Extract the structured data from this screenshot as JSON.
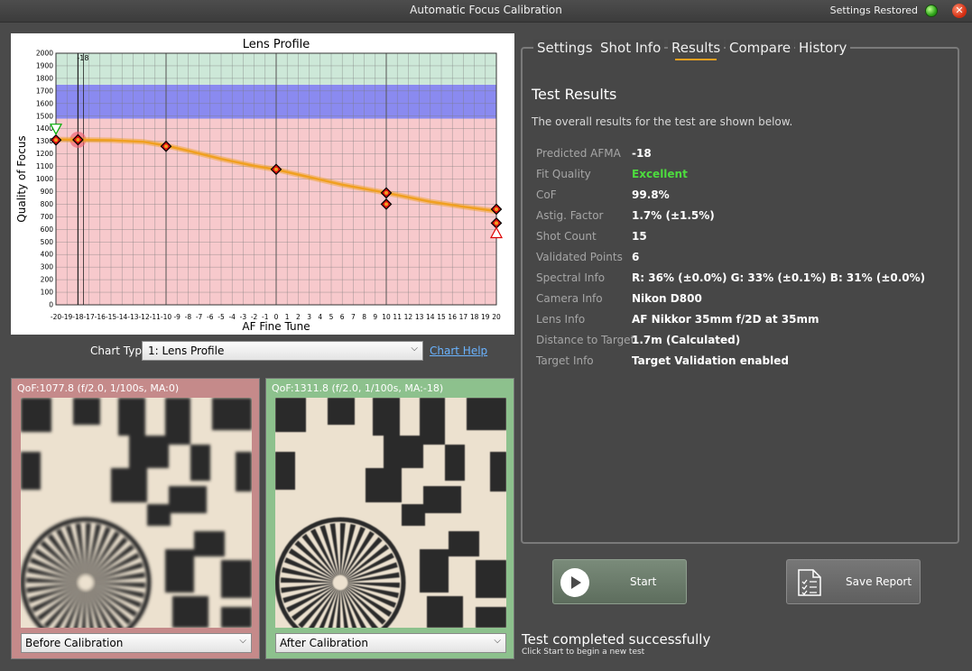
{
  "window": {
    "title": "Automatic Focus Calibration",
    "status_text": "Settings Restored",
    "close_glyph": "✕"
  },
  "chart_data": {
    "type": "line",
    "title": "Lens Profile",
    "xlabel": "AF Fine Tune",
    "ylabel": "Quality of Focus",
    "xlim": [
      -20,
      20
    ],
    "ylim": [
      0,
      2000
    ],
    "x_ticks": [
      -20,
      -19,
      -18,
      -17,
      -16,
      -15,
      -14,
      -13,
      -12,
      -11,
      -10,
      -9,
      -8,
      -7,
      -6,
      -5,
      -4,
      -3,
      -2,
      -1,
      0,
      1,
      2,
      3,
      4,
      5,
      6,
      7,
      8,
      9,
      10,
      11,
      12,
      13,
      14,
      15,
      16,
      17,
      18,
      19,
      20
    ],
    "y_ticks": [
      0,
      100,
      200,
      300,
      400,
      500,
      600,
      700,
      800,
      900,
      1000,
      1100,
      1200,
      1300,
      1400,
      1500,
      1600,
      1700,
      1800,
      1900,
      2000
    ],
    "grid": true,
    "bands": [
      {
        "from": 0,
        "to": 1480,
        "color": "#f7c9cc"
      },
      {
        "from": 1480,
        "to": 1750,
        "color": "#8a8af0"
      },
      {
        "from": 1750,
        "to": 2000,
        "color": "#cde8d8"
      }
    ],
    "predicted_marker": {
      "x": -18,
      "label": "-18"
    },
    "fit_curve": {
      "name": "Fit",
      "color": "#f0a020",
      "x": [
        -20,
        -18,
        -15,
        -12,
        -10,
        -8,
        -5,
        -2,
        0,
        3,
        6,
        10,
        14,
        17,
        20
      ],
      "y": [
        1315,
        1312,
        1308,
        1295,
        1265,
        1225,
        1160,
        1105,
        1075,
        1015,
        955,
        890,
        820,
        780,
        745
      ]
    },
    "points": [
      {
        "x": -20,
        "y": 1310
      },
      {
        "x": -18,
        "y": 1312
      },
      {
        "x": -10,
        "y": 1260
      },
      {
        "x": 0,
        "y": 1077
      },
      {
        "x": 10,
        "y": 890
      },
      {
        "x": 10,
        "y": 800
      },
      {
        "x": 20,
        "y": 760
      },
      {
        "x": 20,
        "y": 650
      }
    ],
    "min_marker": {
      "x": 20,
      "y": 570
    },
    "max_marker": {
      "x": -20,
      "y": 1400
    }
  },
  "chart_controls": {
    "type_label": "Chart Type",
    "type_value": "1: Lens Profile",
    "help_link": "Chart Help"
  },
  "images": {
    "before": {
      "qof": "QoF:1077.8 (f/2.0, 1/100s, MA:0)",
      "select": "Before Calibration",
      "blur": 1.6
    },
    "after": {
      "qof": "QoF:1311.8 (f/2.0, 1/100s, MA:-18)",
      "select": "After Calibration",
      "blur": 0.55
    }
  },
  "tabs": [
    {
      "label": "Settings",
      "active": false
    },
    {
      "label": "Shot Info",
      "active": false
    },
    {
      "label": "Results",
      "active": true
    },
    {
      "label": "Compare",
      "active": false
    },
    {
      "label": "History",
      "active": false
    }
  ],
  "results": {
    "title": "Test Results",
    "subtitle": "The overall results for the test are shown below.",
    "rows": [
      {
        "label": "Predicted AFMA",
        "value": "-18"
      },
      {
        "label": "Fit Quality",
        "value": "Excellent",
        "highlight": true
      },
      {
        "label": "CoF",
        "value": "99.8%"
      },
      {
        "label": "Astig. Factor",
        "value": "1.7% (±1.5%)"
      },
      {
        "label": "Shot Count",
        "value": "15"
      },
      {
        "label": "Validated Points",
        "value": "6"
      },
      {
        "label": "Spectral Info",
        "value": "R: 36% (±0.0%) G: 33% (±0.1%) B: 31% (±0.0%)"
      },
      {
        "label": "Camera Info",
        "value": "Nikon D800"
      },
      {
        "label": "Lens Info",
        "value": "AF Nikkor 35mm f/2D at 35mm"
      },
      {
        "label": "Distance to Target",
        "value": "1.7m (Calculated)"
      },
      {
        "label": "Target Info",
        "value": "Target Validation enabled"
      }
    ]
  },
  "buttons": {
    "start": "Start",
    "save_report": "Save Report"
  },
  "status": {
    "main": "Test completed successfully",
    "sub": "Click Start to begin a new test"
  }
}
